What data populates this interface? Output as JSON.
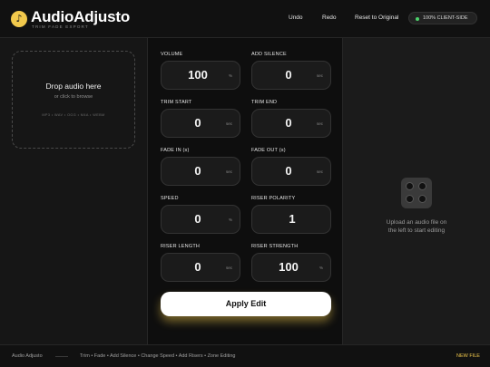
{
  "header": {
    "logo_icon": "music-note-icon",
    "logo_glyph": "♪",
    "title": "AudioAdjusto",
    "subtitle": "TRIM FADE EXPORT",
    "nav": {
      "undo": "Undo",
      "redo": "Redo",
      "reset": "Reset to Original"
    },
    "client_badge": "100% CLIENT-SIDE"
  },
  "drop_zone": {
    "title": "Drop audio here",
    "subtitle": "or click to browse",
    "formats": "MP3 • WAV • OGG • M4A • WEBM"
  },
  "fields": [
    {
      "id": "volume",
      "label": "VOLUME",
      "value": "100",
      "unit": "%"
    },
    {
      "id": "add-silence",
      "label": "ADD SILENCE",
      "value": "0",
      "unit": "sec"
    },
    {
      "id": "trim-start",
      "label": "TRIM START",
      "value": "0",
      "unit": "sec"
    },
    {
      "id": "trim-end",
      "label": "TRIM END",
      "value": "0",
      "unit": "sec"
    },
    {
      "id": "fade-in",
      "label": "FADE IN (s)",
      "value": "0",
      "unit": "sec"
    },
    {
      "id": "fade-out",
      "label": "FADE OUT (s)",
      "value": "0",
      "unit": "sec"
    },
    {
      "id": "speed",
      "label": "SPEED",
      "value": "0",
      "unit": "%"
    },
    {
      "id": "riser-polarity",
      "label": "RISER POLARITY",
      "value": "1",
      "unit": ""
    },
    {
      "id": "riser-length",
      "label": "RISER LENGTH",
      "value": "0",
      "unit": "sec"
    },
    {
      "id": "riser-strength",
      "label": "RISER STRENGTH",
      "value": "100",
      "unit": "%"
    }
  ],
  "apply_label": "Apply Edit",
  "preview": {
    "icon": "speaker-knobs-icon",
    "empty_line1": "Upload an audio file on",
    "empty_line2": "the left to start editing"
  },
  "footer": {
    "brand": "Audio Adjusto",
    "features": "Trim • Fade • Add Silence • Change Speed • Add Risers • Zone Editing",
    "new_file": "NEW FILE"
  },
  "colors": {
    "accent": "#f2c94c",
    "status_ok": "#4cd36b",
    "background": "#161616"
  }
}
